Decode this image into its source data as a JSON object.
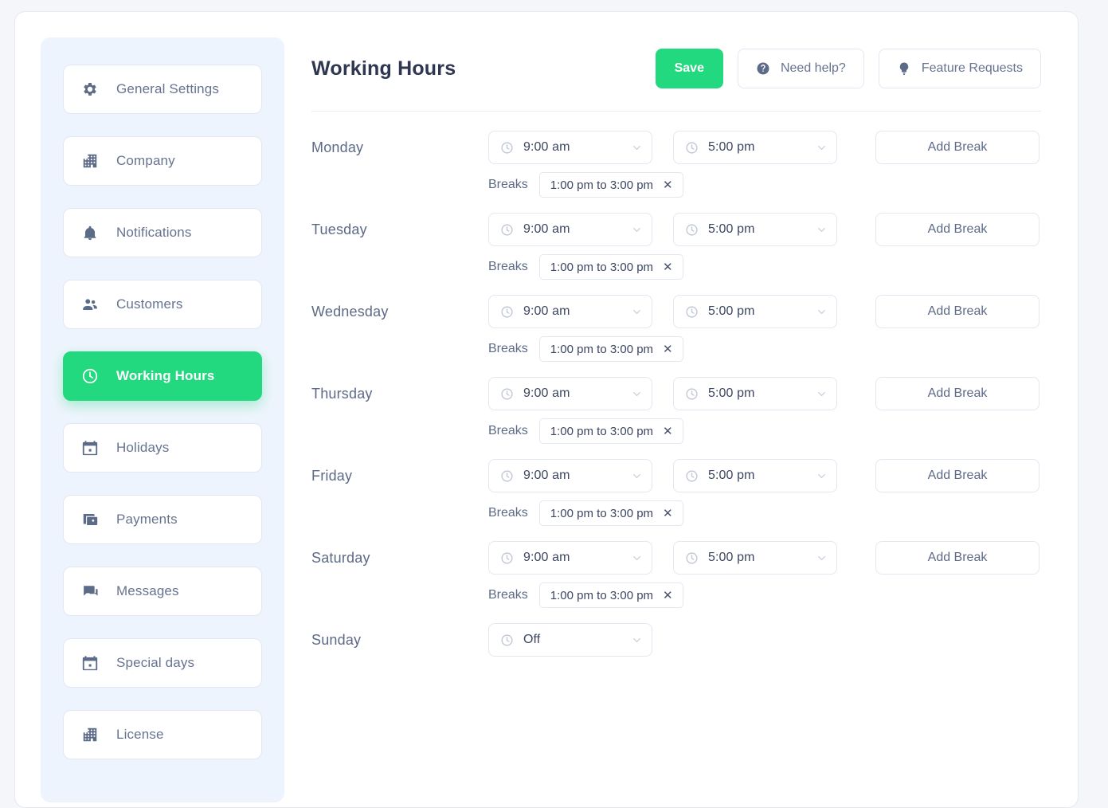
{
  "accent_color": "#22d97f",
  "sidebar": {
    "items": [
      {
        "label": "General Settings",
        "icon": "gear-icon",
        "active": false
      },
      {
        "label": "Company",
        "icon": "building-icon",
        "active": false
      },
      {
        "label": "Notifications",
        "icon": "bell-icon",
        "active": false
      },
      {
        "label": "Customers",
        "icon": "people-icon",
        "active": false
      },
      {
        "label": "Working Hours",
        "icon": "clock-icon",
        "active": true
      },
      {
        "label": "Holidays",
        "icon": "calendar-icon",
        "active": false
      },
      {
        "label": "Payments",
        "icon": "wallet-icon",
        "active": false
      },
      {
        "label": "Messages",
        "icon": "chat-icon",
        "active": false
      },
      {
        "label": "Special days",
        "icon": "calendar-icon",
        "active": false
      },
      {
        "label": "License",
        "icon": "building-icon",
        "active": false
      }
    ]
  },
  "header": {
    "title": "Working Hours",
    "save_label": "Save",
    "need_help_label": "Need help?",
    "feature_requests_label": "Feature Requests"
  },
  "labels": {
    "breaks": "Breaks",
    "add_break": "Add Break",
    "remove_break": "✕"
  },
  "days": [
    {
      "name": "Monday",
      "start": "9:00 am",
      "end": "5:00 pm",
      "off": false,
      "breaks": [
        "1:00 pm to 3:00 pm"
      ]
    },
    {
      "name": "Tuesday",
      "start": "9:00 am",
      "end": "5:00 pm",
      "off": false,
      "breaks": [
        "1:00 pm to 3:00 pm"
      ]
    },
    {
      "name": "Wednesday",
      "start": "9:00 am",
      "end": "5:00 pm",
      "off": false,
      "breaks": [
        "1:00 pm to 3:00 pm"
      ]
    },
    {
      "name": "Thursday",
      "start": "9:00 am",
      "end": "5:00 pm",
      "off": false,
      "breaks": [
        "1:00 pm to 3:00 pm"
      ]
    },
    {
      "name": "Friday",
      "start": "9:00 am",
      "end": "5:00 pm",
      "off": false,
      "breaks": [
        "1:00 pm to 3:00 pm"
      ]
    },
    {
      "name": "Saturday",
      "start": "9:00 am",
      "end": "5:00 pm",
      "off": false,
      "breaks": [
        "1:00 pm to 3:00 pm"
      ]
    },
    {
      "name": "Sunday",
      "start": "Off",
      "end": null,
      "off": true,
      "breaks": []
    }
  ]
}
